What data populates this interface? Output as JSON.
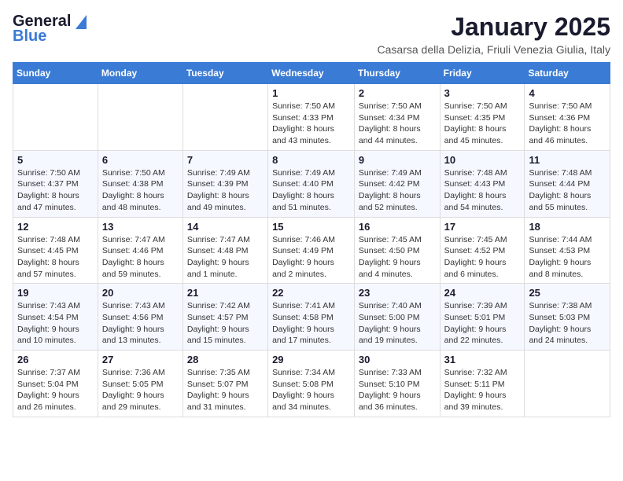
{
  "header": {
    "logo_line1": "General",
    "logo_line2": "Blue",
    "month_title": "January 2025",
    "subtitle": "Casarsa della Delizia, Friuli Venezia Giulia, Italy"
  },
  "days_of_week": [
    "Sunday",
    "Monday",
    "Tuesday",
    "Wednesday",
    "Thursday",
    "Friday",
    "Saturday"
  ],
  "weeks": [
    [
      {
        "day": "",
        "info": ""
      },
      {
        "day": "",
        "info": ""
      },
      {
        "day": "",
        "info": ""
      },
      {
        "day": "1",
        "info": "Sunrise: 7:50 AM\nSunset: 4:33 PM\nDaylight: 8 hours and 43 minutes."
      },
      {
        "day": "2",
        "info": "Sunrise: 7:50 AM\nSunset: 4:34 PM\nDaylight: 8 hours and 44 minutes."
      },
      {
        "day": "3",
        "info": "Sunrise: 7:50 AM\nSunset: 4:35 PM\nDaylight: 8 hours and 45 minutes."
      },
      {
        "day": "4",
        "info": "Sunrise: 7:50 AM\nSunset: 4:36 PM\nDaylight: 8 hours and 46 minutes."
      }
    ],
    [
      {
        "day": "5",
        "info": "Sunrise: 7:50 AM\nSunset: 4:37 PM\nDaylight: 8 hours and 47 minutes."
      },
      {
        "day": "6",
        "info": "Sunrise: 7:50 AM\nSunset: 4:38 PM\nDaylight: 8 hours and 48 minutes."
      },
      {
        "day": "7",
        "info": "Sunrise: 7:49 AM\nSunset: 4:39 PM\nDaylight: 8 hours and 49 minutes."
      },
      {
        "day": "8",
        "info": "Sunrise: 7:49 AM\nSunset: 4:40 PM\nDaylight: 8 hours and 51 minutes."
      },
      {
        "day": "9",
        "info": "Sunrise: 7:49 AM\nSunset: 4:42 PM\nDaylight: 8 hours and 52 minutes."
      },
      {
        "day": "10",
        "info": "Sunrise: 7:48 AM\nSunset: 4:43 PM\nDaylight: 8 hours and 54 minutes."
      },
      {
        "day": "11",
        "info": "Sunrise: 7:48 AM\nSunset: 4:44 PM\nDaylight: 8 hours and 55 minutes."
      }
    ],
    [
      {
        "day": "12",
        "info": "Sunrise: 7:48 AM\nSunset: 4:45 PM\nDaylight: 8 hours and 57 minutes."
      },
      {
        "day": "13",
        "info": "Sunrise: 7:47 AM\nSunset: 4:46 PM\nDaylight: 8 hours and 59 minutes."
      },
      {
        "day": "14",
        "info": "Sunrise: 7:47 AM\nSunset: 4:48 PM\nDaylight: 9 hours and 1 minute."
      },
      {
        "day": "15",
        "info": "Sunrise: 7:46 AM\nSunset: 4:49 PM\nDaylight: 9 hours and 2 minutes."
      },
      {
        "day": "16",
        "info": "Sunrise: 7:45 AM\nSunset: 4:50 PM\nDaylight: 9 hours and 4 minutes."
      },
      {
        "day": "17",
        "info": "Sunrise: 7:45 AM\nSunset: 4:52 PM\nDaylight: 9 hours and 6 minutes."
      },
      {
        "day": "18",
        "info": "Sunrise: 7:44 AM\nSunset: 4:53 PM\nDaylight: 9 hours and 8 minutes."
      }
    ],
    [
      {
        "day": "19",
        "info": "Sunrise: 7:43 AM\nSunset: 4:54 PM\nDaylight: 9 hours and 10 minutes."
      },
      {
        "day": "20",
        "info": "Sunrise: 7:43 AM\nSunset: 4:56 PM\nDaylight: 9 hours and 13 minutes."
      },
      {
        "day": "21",
        "info": "Sunrise: 7:42 AM\nSunset: 4:57 PM\nDaylight: 9 hours and 15 minutes."
      },
      {
        "day": "22",
        "info": "Sunrise: 7:41 AM\nSunset: 4:58 PM\nDaylight: 9 hours and 17 minutes."
      },
      {
        "day": "23",
        "info": "Sunrise: 7:40 AM\nSunset: 5:00 PM\nDaylight: 9 hours and 19 minutes."
      },
      {
        "day": "24",
        "info": "Sunrise: 7:39 AM\nSunset: 5:01 PM\nDaylight: 9 hours and 22 minutes."
      },
      {
        "day": "25",
        "info": "Sunrise: 7:38 AM\nSunset: 5:03 PM\nDaylight: 9 hours and 24 minutes."
      }
    ],
    [
      {
        "day": "26",
        "info": "Sunrise: 7:37 AM\nSunset: 5:04 PM\nDaylight: 9 hours and 26 minutes."
      },
      {
        "day": "27",
        "info": "Sunrise: 7:36 AM\nSunset: 5:05 PM\nDaylight: 9 hours and 29 minutes."
      },
      {
        "day": "28",
        "info": "Sunrise: 7:35 AM\nSunset: 5:07 PM\nDaylight: 9 hours and 31 minutes."
      },
      {
        "day": "29",
        "info": "Sunrise: 7:34 AM\nSunset: 5:08 PM\nDaylight: 9 hours and 34 minutes."
      },
      {
        "day": "30",
        "info": "Sunrise: 7:33 AM\nSunset: 5:10 PM\nDaylight: 9 hours and 36 minutes."
      },
      {
        "day": "31",
        "info": "Sunrise: 7:32 AM\nSunset: 5:11 PM\nDaylight: 9 hours and 39 minutes."
      },
      {
        "day": "",
        "info": ""
      }
    ]
  ]
}
